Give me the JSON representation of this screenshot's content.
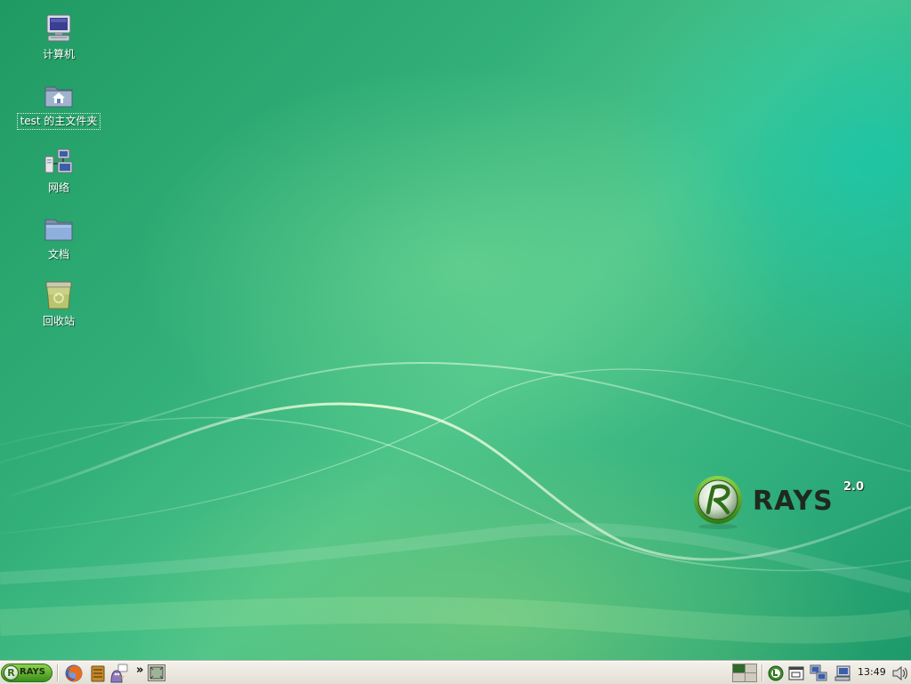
{
  "desktop": {
    "icons": [
      {
        "label": "计算机",
        "icon": "computer-icon"
      },
      {
        "label": "test 的主文件夹",
        "icon": "home-folder-icon",
        "selected": true
      },
      {
        "label": "网络",
        "icon": "network-icon"
      },
      {
        "label": "文档",
        "icon": "folder-icon"
      },
      {
        "label": "回收站",
        "icon": "trash-icon"
      }
    ],
    "brand": {
      "name": "RAYS",
      "version": "2.0"
    },
    "colors": {
      "background_primary": "#2fae7c",
      "background_light": "#6fd49a",
      "background_teal": "#14c8b0"
    }
  },
  "taskbar": {
    "start_label": "RAYS",
    "start_logo_letter": "R",
    "launchers": [
      "firefox-icon",
      "archive-manager-icon",
      "messenger-icon"
    ],
    "overflow_label": "»",
    "show_desktop": "show-desktop-icon",
    "tray_icons": [
      "update-manager-icon",
      "terminal-icon",
      "network-connection-icon",
      "network-status-icon",
      "volume-icon"
    ],
    "clock": "13:49",
    "workspaces": {
      "count": 4,
      "active": 1
    }
  }
}
